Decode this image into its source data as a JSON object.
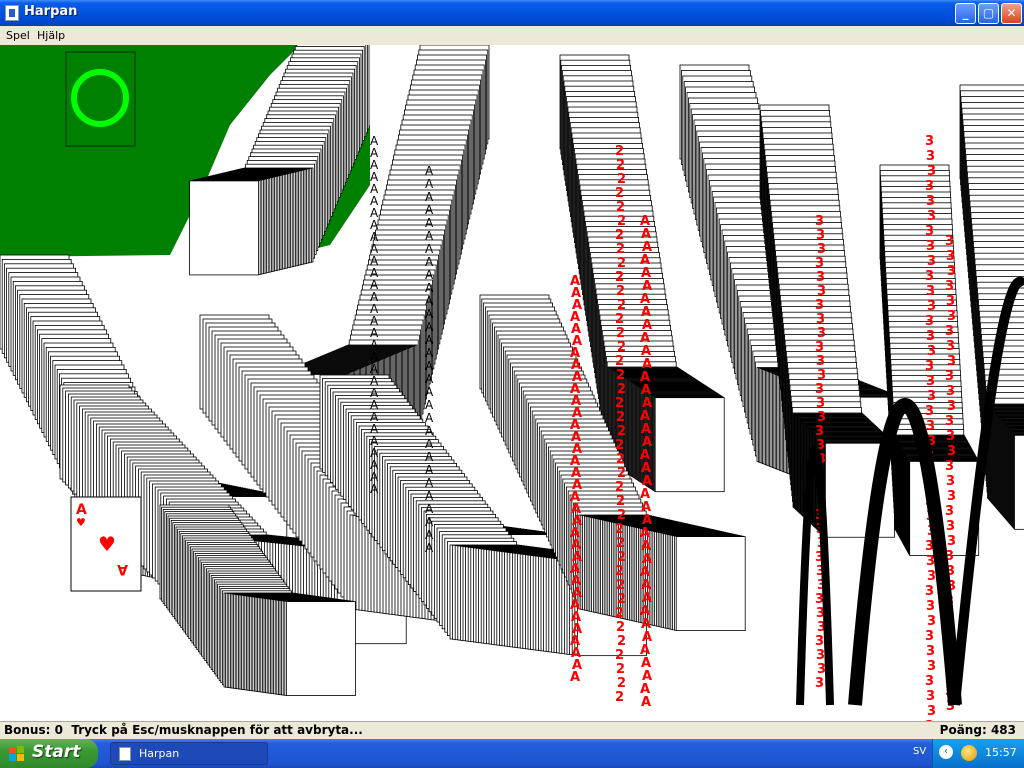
{
  "window": {
    "title": "Harpan"
  },
  "menu": {
    "items": [
      "Spel",
      "Hjälp"
    ]
  },
  "status": {
    "bonus_label": "Bonus:",
    "bonus_value": "0",
    "message": "Tryck på Esc/musknappen för att avbryta...",
    "score_label": "Poäng:",
    "score_value": "483"
  },
  "board": {
    "felt_color": "#008000",
    "stock_ring_color": "#00ff00",
    "featured_card": {
      "rank": "A",
      "suit": "hearts",
      "suit_symbol": "♥"
    },
    "cascade_ranks": [
      "A",
      "2",
      "3"
    ],
    "suit_symbols": {
      "hearts": "♥",
      "spades": "♠"
    }
  },
  "taskbar": {
    "start_label": "Start",
    "tasks": [
      {
        "label": "Harpan"
      }
    ],
    "language": "SV",
    "clock": "15:57"
  }
}
